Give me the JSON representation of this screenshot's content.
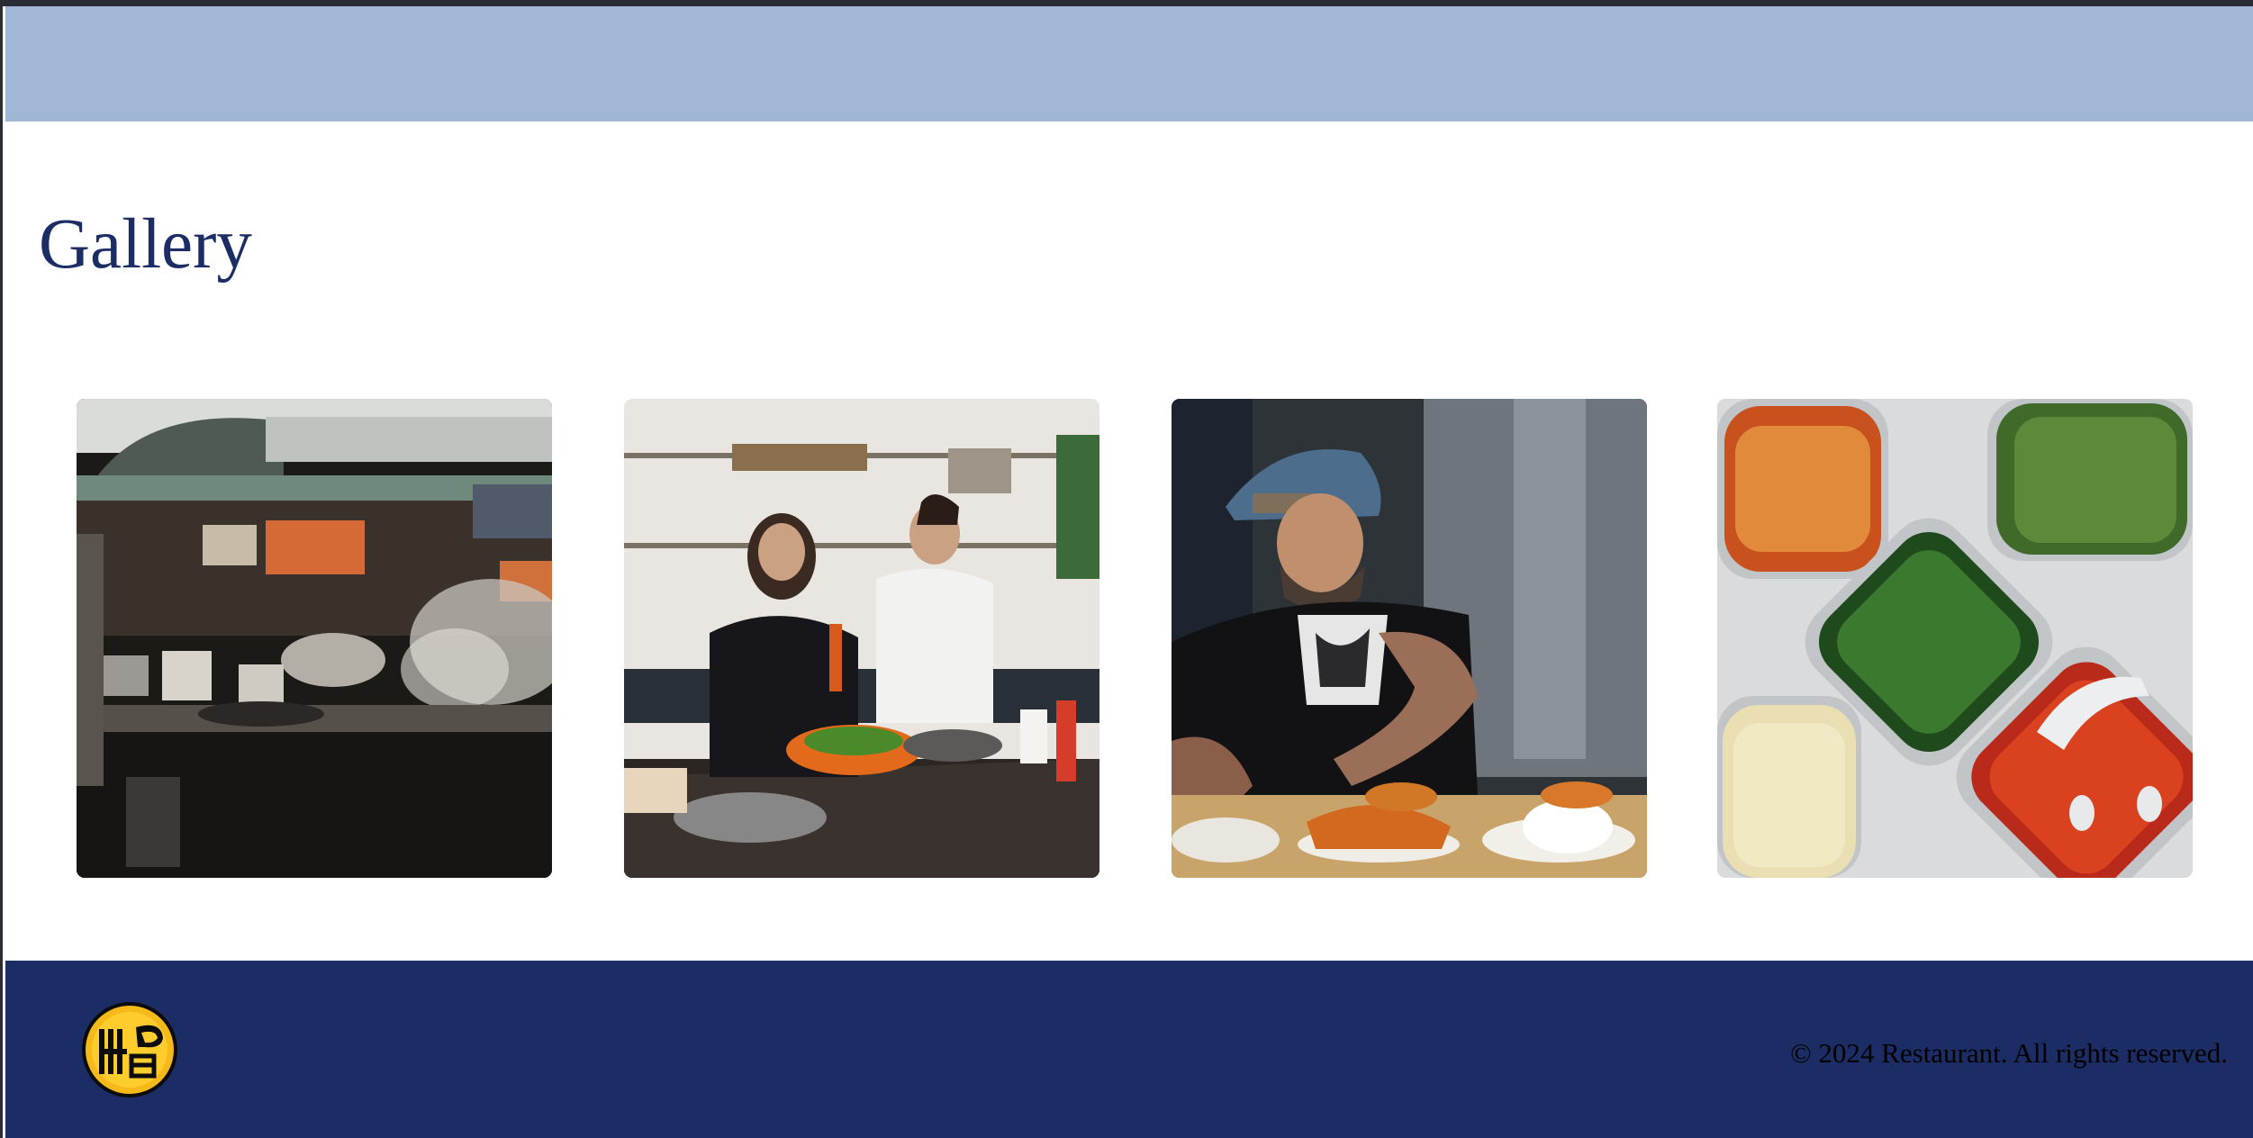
{
  "header": {
    "background_color": "#a2b6d6"
  },
  "main": {
    "title": "Gallery",
    "title_color": "#1c2d66",
    "gallery": [
      {
        "subject": "street-food-stall-photo"
      },
      {
        "subject": "couple-cooking-photo"
      },
      {
        "subject": "chef-plating-photo"
      },
      {
        "subject": "salad-bar-ingredients-photo"
      }
    ]
  },
  "footer": {
    "background_color": "#1c2d66",
    "logo_icon": "restaurant-logo-icon",
    "copyright": "© 2024 Restaurant. All rights reserved."
  }
}
